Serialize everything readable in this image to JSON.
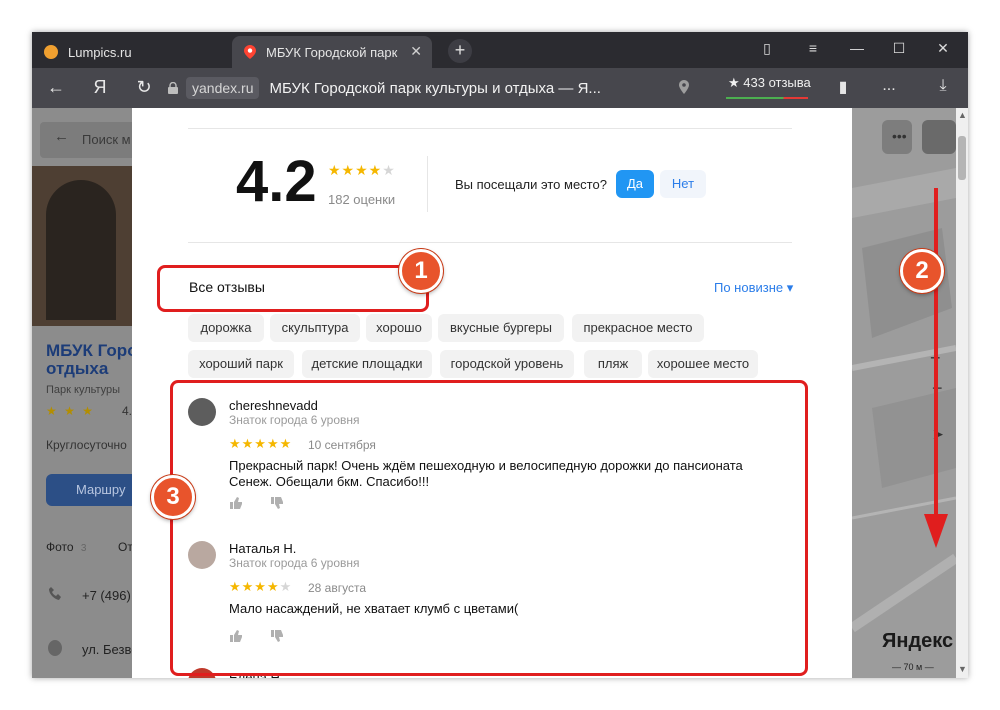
{
  "browser": {
    "tabs": [
      {
        "label": "Lumpics.ru"
      },
      {
        "label": "МБУК Городской парк"
      }
    ],
    "new_tab": "+",
    "yandex_glyph": "Я",
    "domain": "yandex.ru",
    "page_title": "МБУК Городской парк культуры и отдыха — Я...",
    "reviews_button": "★ 433 отзыва",
    "menu_dots": "..."
  },
  "left_panel": {
    "search_placeholder": "Поиск м",
    "place_name_line1": "МБУК Горо",
    "place_name_line2": "отдыха",
    "category": "Парк культуры",
    "stars": "★ ★ ★",
    "rating": "4.",
    "hours": "Круглосуточно",
    "route_button": "Маршру",
    "tab_photo": "Фото",
    "tab_photo_count": "3",
    "tab_other": "От",
    "phone": "+7 (496)",
    "address": "ул. Безве"
  },
  "summary": {
    "rating": "4.2",
    "stars_filled": "★★★★",
    "stars_empty": "★",
    "ratings_count": "182 оценки",
    "visited_question": "Вы посещали это место?",
    "yes": "Да",
    "no": "Нет"
  },
  "reviews_header": {
    "title": "Все отзывы",
    "sort": "По новизне ▾"
  },
  "tags": [
    "дорожка",
    "скульптура",
    "хорошо",
    "вкусные бургеры",
    "прекрасное место",
    "хороший парк",
    "детские площадки",
    "городской уровень",
    "пляж",
    "хорошее место"
  ],
  "reviews": [
    {
      "name": "chereshnevadd",
      "level": "Знаток города 6 уровня",
      "stars_filled": "★★★★★",
      "stars_empty": "",
      "date": "10 сентября",
      "text": "Прекрасный парк! Очень ждём пешеходную и велосипедную дорожки до пансионата Сенеж. Обещали бкм. Спасибо!!!"
    },
    {
      "name": "Наталья Н.",
      "level": "Знаток города 6 уровня",
      "stars_filled": "★★★★",
      "stars_empty": "★",
      "date": "28 августа",
      "text": "Мало насаждений, не хватает клумб с цветами("
    },
    {
      "name": "Елена Н.",
      "level": "",
      "stars_filled": "",
      "stars_empty": "",
      "date": "",
      "text": ""
    }
  ],
  "map": {
    "logo": "Яндекс",
    "scale": "— 70 м —"
  },
  "annotations": [
    "1",
    "2",
    "3"
  ],
  "colors": {
    "accent_blue": "#2196f3",
    "link_blue": "#2b7de9",
    "star_gold": "#f5b700",
    "annotation_red": "#e01e1e",
    "badge_orange": "#e8542c"
  }
}
